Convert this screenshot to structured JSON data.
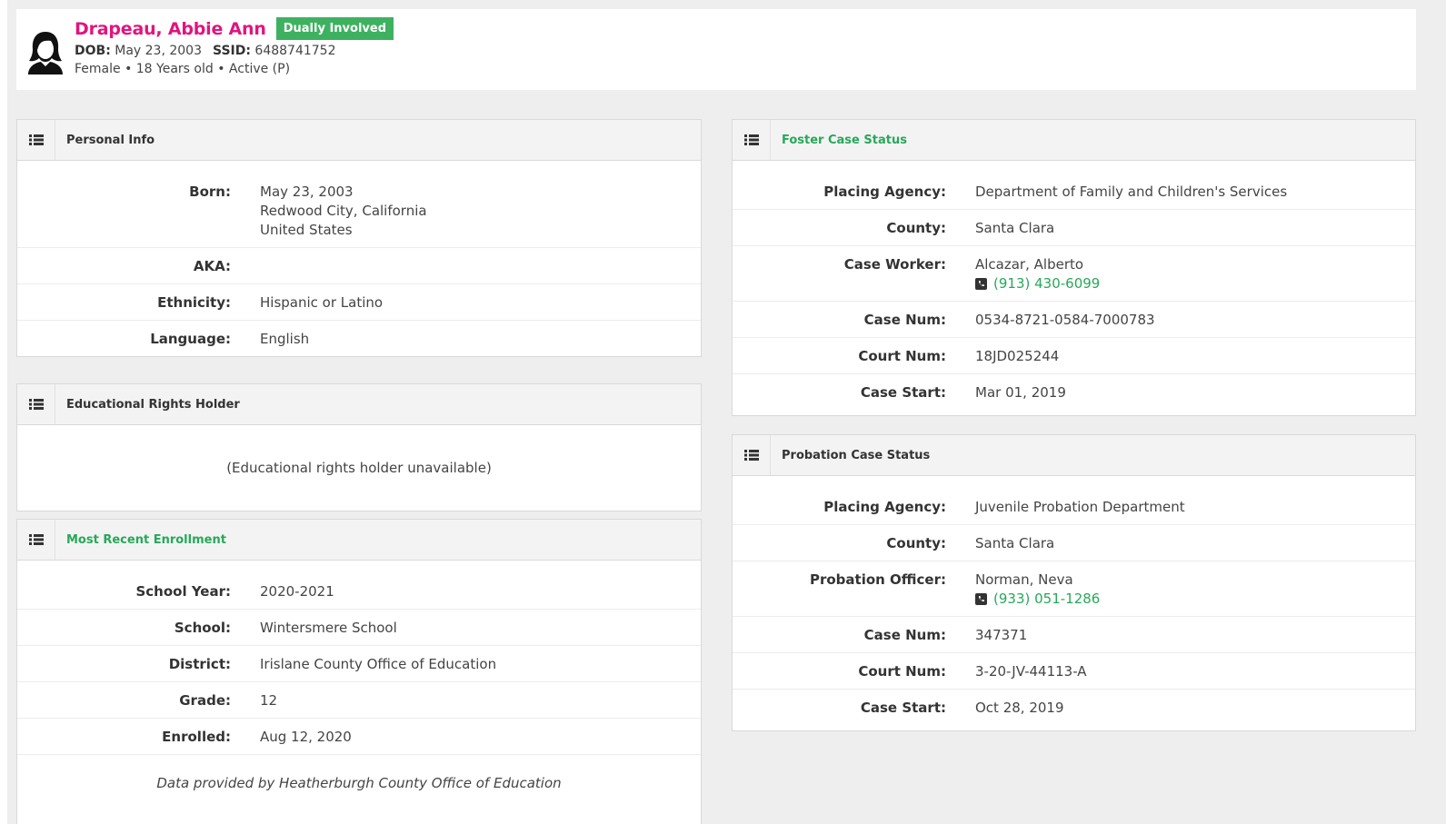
{
  "student": {
    "name": "Drapeau, Abbie Ann",
    "badge": "Dually Involved",
    "dob_label": "DOB:",
    "dob": "May 23, 2003",
    "ssid_label": "SSID:",
    "ssid": "6488741752",
    "summary": "Female • 18 Years old • Active (P)"
  },
  "personal_info": {
    "title": "Personal Info",
    "rows": [
      {
        "label": "Born:",
        "lines": [
          "May 23, 2003",
          "Redwood City, California",
          "United States"
        ]
      },
      {
        "label": "AKA:",
        "lines": [
          ""
        ]
      },
      {
        "label": "Ethnicity:",
        "lines": [
          "Hispanic or Latino"
        ]
      },
      {
        "label": "Language:",
        "lines": [
          "English"
        ]
      }
    ]
  },
  "educational_rights": {
    "title": "Educational Rights Holder",
    "message": "(Educational rights holder unavailable)"
  },
  "enrollment": {
    "title": "Most Recent Enrollment",
    "rows": [
      {
        "label": "School Year:",
        "value": "2020-2021"
      },
      {
        "label": "School:",
        "value": "Wintersmere School"
      },
      {
        "label": "District:",
        "value": "Irislane County Office of Education"
      },
      {
        "label": "Grade:",
        "value": "12"
      },
      {
        "label": "Enrolled:",
        "value": "Aug 12, 2020"
      }
    ],
    "footnote": "Data provided by Heatherburgh County Office of Education"
  },
  "foster": {
    "title": "Foster Case Status",
    "rows": [
      {
        "label": "Placing Agency:",
        "value": "Department of Family and Children's Services"
      },
      {
        "label": "County:",
        "value": "Santa Clara"
      },
      {
        "label": "Case Worker:",
        "value": "Alcazar, Alberto",
        "phone": "(913) 430-6099"
      },
      {
        "label": "Case Num:",
        "value": "0534-8721-0584-7000783"
      },
      {
        "label": "Court Num:",
        "value": "18JD025244"
      },
      {
        "label": "Case Start:",
        "value": "Mar 01, 2019"
      }
    ]
  },
  "probation": {
    "title": "Probation Case Status",
    "rows": [
      {
        "label": "Placing Agency:",
        "value": "Juvenile Probation Department"
      },
      {
        "label": "County:",
        "value": "Santa Clara"
      },
      {
        "label": "Probation Officer:",
        "value": "Norman, Neva",
        "phone": "(933) 051-1286"
      },
      {
        "label": "Case Num:",
        "value": "347371"
      },
      {
        "label": "Court Num:",
        "value": "3-20-JV-44113-A"
      },
      {
        "label": "Case Start:",
        "value": "Oct 28, 2019"
      }
    ]
  },
  "colors": {
    "name": "#e0157f",
    "badge": "#3eb160",
    "accent_green": "#27a85a"
  },
  "icons": {
    "avatar": "female-user-icon",
    "panel": "list-icon",
    "phone": "phone-icon"
  }
}
